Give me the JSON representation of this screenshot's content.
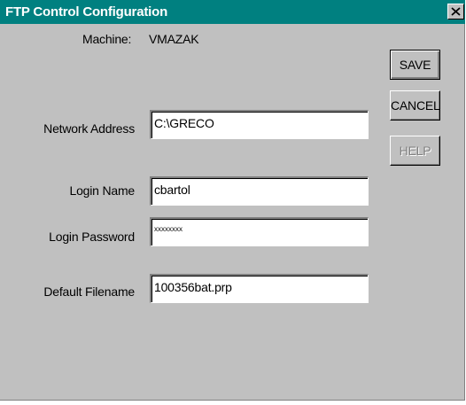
{
  "window": {
    "title": "FTP Control Configuration",
    "close_label": "×"
  },
  "colors": {
    "titlebar": "#008080",
    "face": "#c0c0c0",
    "disabled_text": "#808080"
  },
  "machine": {
    "label": "Machine:",
    "value": "VMAZAK"
  },
  "fields": {
    "network_address": {
      "label": "Network Address",
      "value": "C:\\GRECO"
    },
    "login_name": {
      "label": "Login Name",
      "value": "cbartol"
    },
    "login_password": {
      "label": "Login Password",
      "value": "xxxxxxxx"
    },
    "default_filename": {
      "label": "Default Filename",
      "value": "100356bat.prp"
    }
  },
  "buttons": {
    "save": "SAVE",
    "cancel": "CANCEL",
    "help": "HELP",
    "help_enabled": false
  },
  "icons": {
    "close": "close-icon"
  }
}
